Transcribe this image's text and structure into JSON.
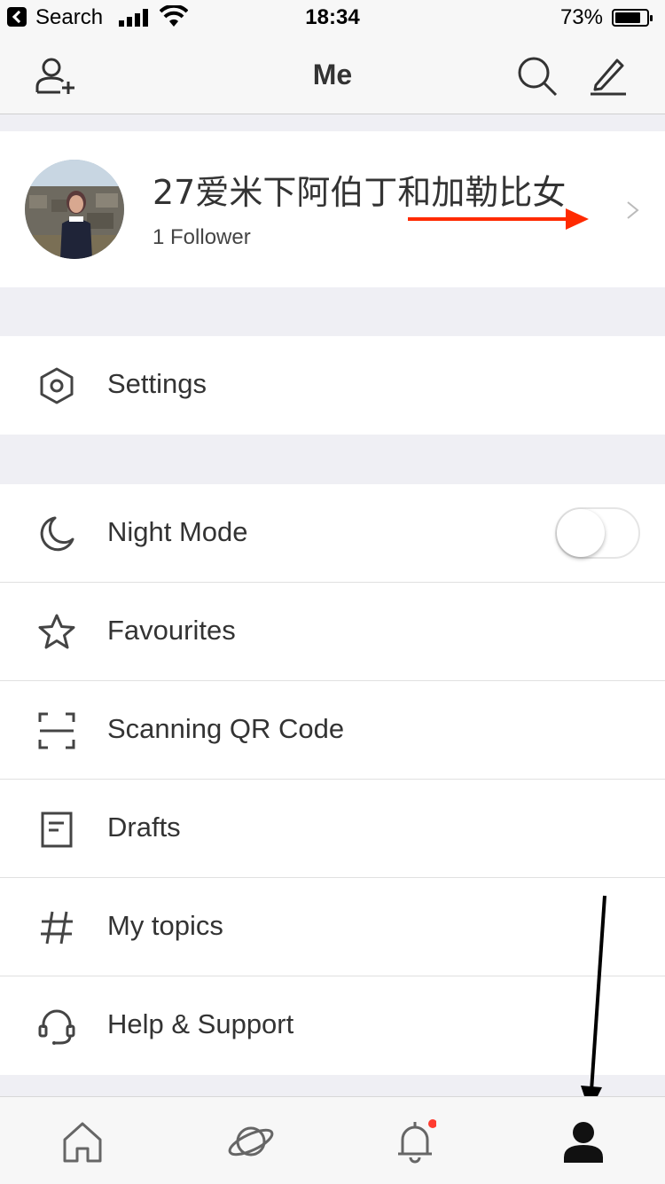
{
  "status_bar": {
    "carrier": "Search",
    "time": "18:34",
    "battery": "73%"
  },
  "nav": {
    "title": "Me",
    "icons": [
      "add-friend-icon",
      "search-icon",
      "edit-icon"
    ]
  },
  "profile": {
    "name": "27爱米下阿伯丁和加勒比女",
    "followers": "1 Follower"
  },
  "settings_group": {
    "items": [
      {
        "label": "Settings",
        "icon": "hexagon-settings-icon"
      }
    ]
  },
  "menu_group": {
    "items": [
      {
        "label": "Night Mode",
        "icon": "moon-icon",
        "toggle": false
      },
      {
        "label": "Favourites",
        "icon": "star-icon"
      },
      {
        "label": "Scanning QR Code",
        "icon": "scan-icon"
      },
      {
        "label": "Drafts",
        "icon": "drafts-icon"
      },
      {
        "label": "My topics",
        "icon": "hashtag-icon"
      },
      {
        "label": "Help & Support",
        "icon": "headset-icon"
      }
    ]
  },
  "tab_bar": {
    "tabs": [
      "home-icon",
      "discover-planet-icon",
      "notifications-bell-icon",
      "profile-person-icon"
    ],
    "active": "profile-person-icon",
    "notification_dot_color": "#ff3b30"
  },
  "annotations": {
    "red_arrow_color": "#ff2a00",
    "black_arrow_color": "#000000"
  }
}
